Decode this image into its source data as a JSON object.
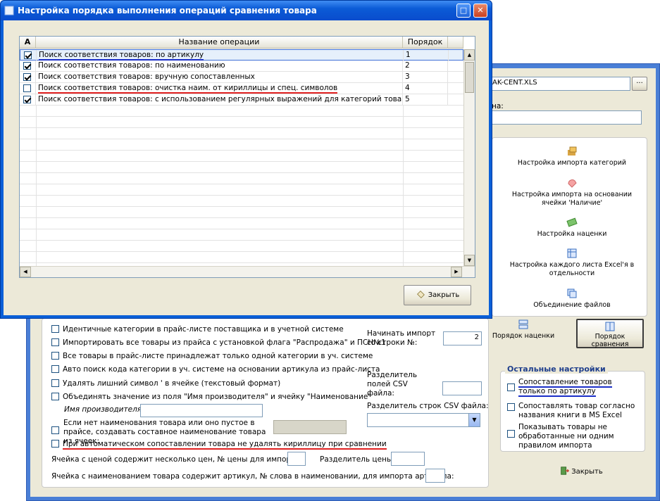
{
  "dialog": {
    "title": "Настройка порядка выполнения операций сравнения товара",
    "close_label": "Закрыть",
    "columns": [
      "A",
      "Название операции",
      "Порядок"
    ],
    "rows": [
      {
        "checked": true,
        "name": "Поиск соответствия товаров: по артикулу",
        "order": "1"
      },
      {
        "checked": true,
        "name": "Поиск соответствия товаров: по наименованию",
        "order": "2"
      },
      {
        "checked": true,
        "name": "Поиск соответствия товаров: вручную сопоставленных",
        "order": "3"
      },
      {
        "checked": false,
        "name": "Поиск соответствия товаров: очистка наим. от кириллицы и спец. символов",
        "order": "4"
      },
      {
        "checked": true,
        "name": "Поиск соответствия товаров: с использованием регулярных выражений для категорий товара",
        "order": "5"
      }
    ]
  },
  "back": {
    "file_value": "AK-CENT.XLS",
    "browse_label": "...",
    "field_label": "на:",
    "tools": [
      {
        "icon": "category-import-icon",
        "label": "Настройка импорта категорий"
      },
      {
        "icon": "availability-icon",
        "label": "Настройка импорта на основании ячейки 'Наличие'"
      },
      {
        "icon": "markup-icon",
        "label": "Настройка наценки"
      },
      {
        "icon": "excel-sheet-icon",
        "label": "Настройка каждого листа Excel'я в отдельности"
      },
      {
        "icon": "merge-files-icon",
        "label": "Объединение файлов"
      }
    ],
    "markup_order_label": "Порядок наценки",
    "compare_order_label": "Порядок сравнения",
    "other_settings_title": "Остальные настройки",
    "other_settings": [
      {
        "checked": false,
        "label": "Сопоставление товаров только по артикулу"
      },
      {
        "checked": false,
        "label": "Сопоставлять товар согласно названия книги в MS Excel"
      },
      {
        "checked": false,
        "label": "Показывать товары не обработанные ни одним правилом импорта"
      }
    ],
    "close_label": "Закрыть",
    "options": [
      "Идентичные категории в прайс-листе поставщика и в учетной системе",
      "Импортировать все товары из прайса с установкой флага \"Распродажа\" и ПСН№1",
      "Все товары в прайс-листе принадлежат только одной категории в уч. системе",
      "Авто поиск кода категории в уч. системе на основании артикула из прайс-листа",
      "Удалять лишний символ ' в ячейке (текстовый формат)",
      "Объединять значение из поля \"Имя производителя\" и ячейку \"Наименование\""
    ],
    "manufacturer_label": "Имя производителя:",
    "empty_name_label": "Если нет наименования товара или оно пустое в прайсе, создавать составное наименование товара из ячеек:",
    "keep_cyrillic_label": "При автоматическом сопоставлении товара не удалять кириллицу при сравнении",
    "price_cell_label": "Ячейка с ценой содержит несколько цен, № цены для импорта:",
    "price_separator_label": "Разделитель цены:",
    "name_cell_label": "Ячейка с наименованием товара содержит артикул, № слова в наименовании, для импорта артикула:",
    "start_row_label": "Начинать импорт со строки №:",
    "start_row_value": "2",
    "csv_field_sep_label": "Разделитель полей CSV файла:",
    "csv_row_sep_label": "Разделитель строк CSV файла:"
  }
}
